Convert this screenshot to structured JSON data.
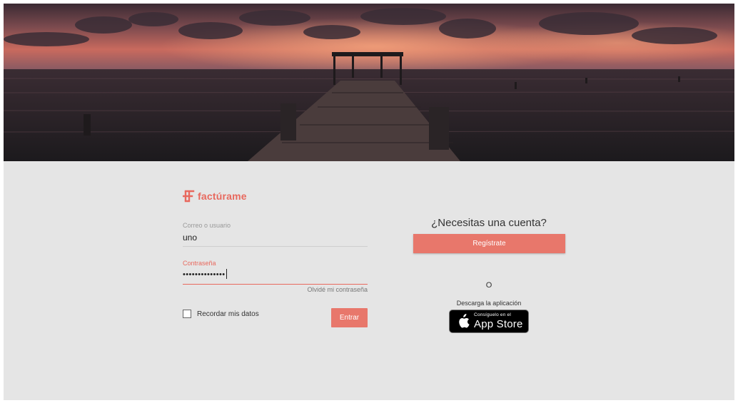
{
  "brand": {
    "name": "factúrame",
    "accent_color": "#e8695e",
    "logo_icon": "factura-logo-icon"
  },
  "hero": {
    "image_description_icon": "pier-sunset-image"
  },
  "login": {
    "email_label": "Correo o usuario",
    "email_value": "uno",
    "password_label": "Contraseña",
    "password_value": "••••••••••••••",
    "forgot_password": "Olvidé mi contraseña",
    "remember_label": "Recordar mis datos",
    "remember_checked": false,
    "submit_label": "Entrar"
  },
  "signup": {
    "heading": "¿Necesitas una cuenta?",
    "register_label": "Regístrate",
    "or_text": "O",
    "download_text": "Descarga la aplicación",
    "appstore_small": "Consíguelo en el",
    "appstore_big": "App Store",
    "appstore_icon": "apple-icon"
  }
}
